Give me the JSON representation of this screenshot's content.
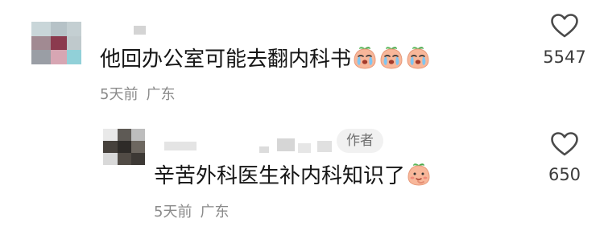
{
  "comments": [
    {
      "text": "他回办公室可能去翻内科书",
      "emojis": [
        "crying-peach-icon",
        "crying-peach-icon",
        "crying-peach-icon"
      ],
      "time": "5天前",
      "location": "广东",
      "likes": "5547"
    },
    {
      "badge": "作者",
      "text": "辛苦外科医生补内科知识了",
      "emojis": [
        "shy-peach-icon"
      ],
      "time": "5天前",
      "location": "广东",
      "likes": "650"
    }
  ],
  "colors": {
    "text": "#151515",
    "meta": "#8a8a8a",
    "badge_bg": "#f1f1f1",
    "heart_stroke": "#4a4a4a"
  }
}
